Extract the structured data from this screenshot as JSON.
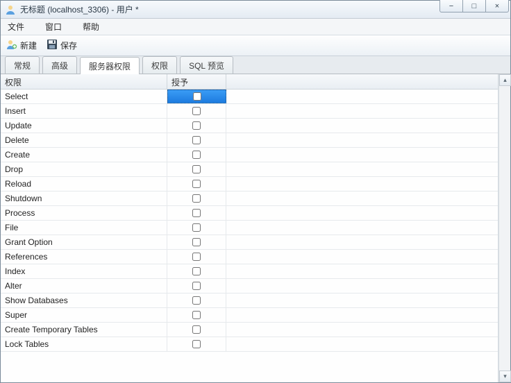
{
  "window": {
    "title": "无标题 (localhost_3306) - 用户 *"
  },
  "menu": {
    "file": "文件",
    "window": "窗口",
    "help": "帮助"
  },
  "toolbar": {
    "new_label": "新建",
    "save_label": "保存"
  },
  "tabs": {
    "general": "常规",
    "advanced": "高级",
    "server_priv": "服务器权限",
    "priv": "权限",
    "sql_preview": "SQL 预览"
  },
  "grid": {
    "header_privilege": "权限",
    "header_grant": "授予",
    "rows": [
      {
        "name": "Select",
        "granted": false,
        "selected": true
      },
      {
        "name": "Insert",
        "granted": false
      },
      {
        "name": "Update",
        "granted": false
      },
      {
        "name": "Delete",
        "granted": false
      },
      {
        "name": "Create",
        "granted": false
      },
      {
        "name": "Drop",
        "granted": false
      },
      {
        "name": "Reload",
        "granted": false
      },
      {
        "name": "Shutdown",
        "granted": false
      },
      {
        "name": "Process",
        "granted": false
      },
      {
        "name": "File",
        "granted": false
      },
      {
        "name": "Grant Option",
        "granted": false
      },
      {
        "name": "References",
        "granted": false
      },
      {
        "name": "Index",
        "granted": false
      },
      {
        "name": "Alter",
        "granted": false
      },
      {
        "name": "Show Databases",
        "granted": false
      },
      {
        "name": "Super",
        "granted": false
      },
      {
        "name": "Create Temporary Tables",
        "granted": false
      },
      {
        "name": "Lock Tables",
        "granted": false
      }
    ]
  },
  "icons": {
    "user": "user-icon",
    "save": "floppy-icon",
    "minimize": "−",
    "maximize": "□",
    "close": "×",
    "scroll_up": "▴",
    "scroll_down": "▾"
  }
}
